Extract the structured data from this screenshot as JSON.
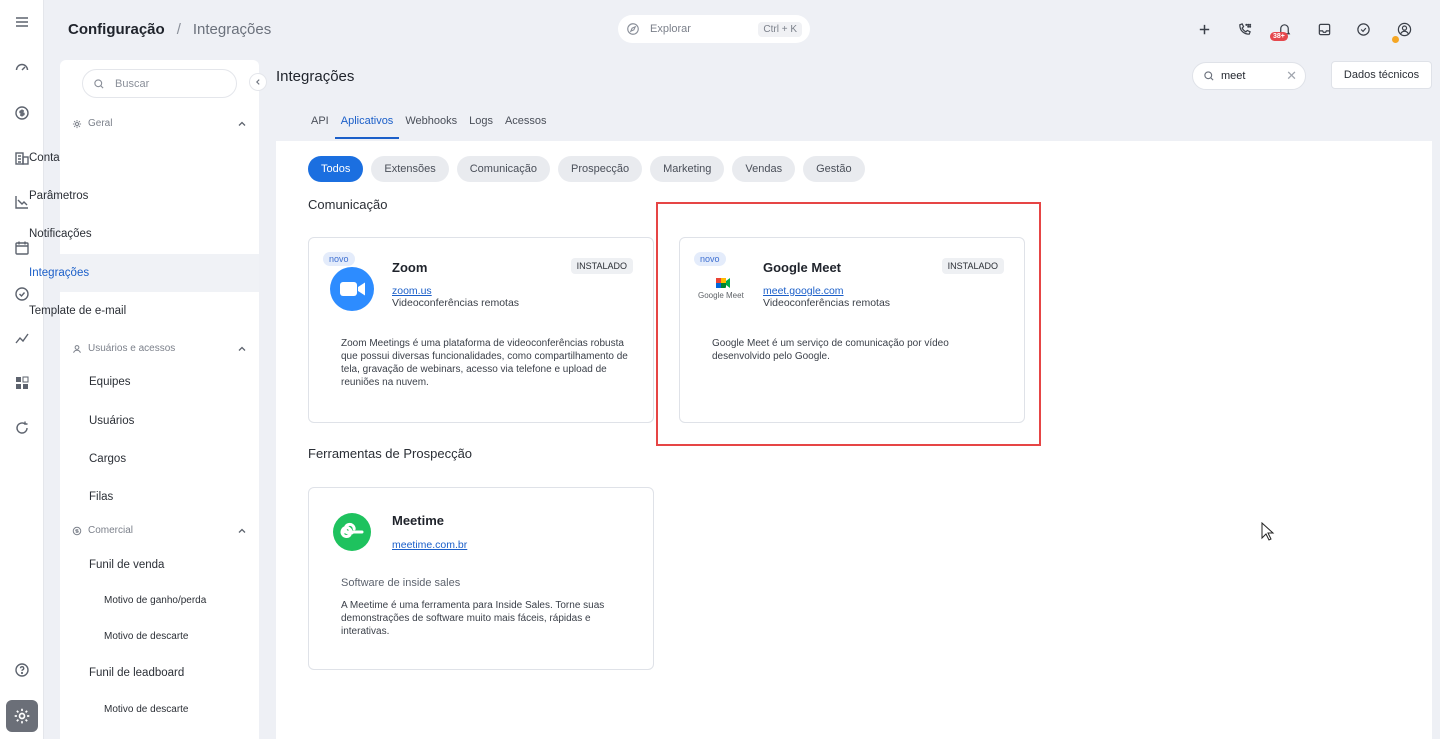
{
  "topbar": {
    "breadcrumb_main": "Configuração",
    "breadcrumb_sep": "/",
    "breadcrumb_sub": "Integrações",
    "explore_label": "Explorar",
    "explore_shortcut": "Ctrl + K",
    "notification_count": "38+"
  },
  "sidebar": {
    "search_placeholder": "Buscar",
    "sections": [
      {
        "label": "Geral",
        "items": [
          "Conta",
          "Parâmetros",
          "Notificações",
          "Integrações",
          "Template de e-mail"
        ]
      },
      {
        "label": "Usuários e acessos",
        "items": [
          "Equipes",
          "Usuários",
          "Cargos",
          "Filas"
        ]
      },
      {
        "label": "Comercial",
        "items": [
          "Funil de venda",
          "Motivo de ganho/perda",
          "Motivo de descarte",
          "Funil de leadboard",
          "Motivo de descarte"
        ]
      }
    ]
  },
  "main": {
    "title": "Integrações",
    "search_value": "meet",
    "tech_button": "Dados técnicos",
    "tabs": [
      "API",
      "Aplicativos",
      "Webhooks",
      "Logs",
      "Acessos"
    ],
    "active_tab": "Aplicativos",
    "chips": [
      "Todos",
      "Extensões",
      "Comunicação",
      "Prospecção",
      "Marketing",
      "Vendas",
      "Gestão"
    ],
    "active_chip": "Todos",
    "sections": [
      {
        "title": "Comunicação",
        "cards": [
          {
            "badge": "novo",
            "name": "Zoom",
            "link": "zoom.us",
            "category": "Videoconferências remotas",
            "status": "INSTALADO",
            "description": "Zoom Meetings é uma plataforma de videoconferências robusta que possui diversas funcionalidades, como compartilhamento de tela, gravação de webinars, acesso via telefone e upload de reuniões na nuvem."
          },
          {
            "badge": "novo",
            "name": "Google Meet",
            "link": "meet.google.com",
            "category": "Videoconferências remotas",
            "status": "INSTALADO",
            "description": "Google Meet é um serviço de comunicação por vídeo desenvolvido pelo Google.",
            "logo_text": "Google Meet"
          }
        ]
      },
      {
        "title": "Ferramentas de Prospecção",
        "cards": [
          {
            "name": "Meetime",
            "link": "meetime.com.br",
            "category": "Software de inside sales",
            "description": "A Meetime é uma ferramenta para Inside Sales. Torne suas demonstrações de software muito mais fáceis, rápidas e interativas."
          }
        ]
      }
    ]
  },
  "colors": {
    "accent": "#1b6fe0",
    "link": "#1b5fc9",
    "highlight": "#e64545",
    "zoom": "#2d8cff",
    "meetime": "#1ec25e"
  }
}
